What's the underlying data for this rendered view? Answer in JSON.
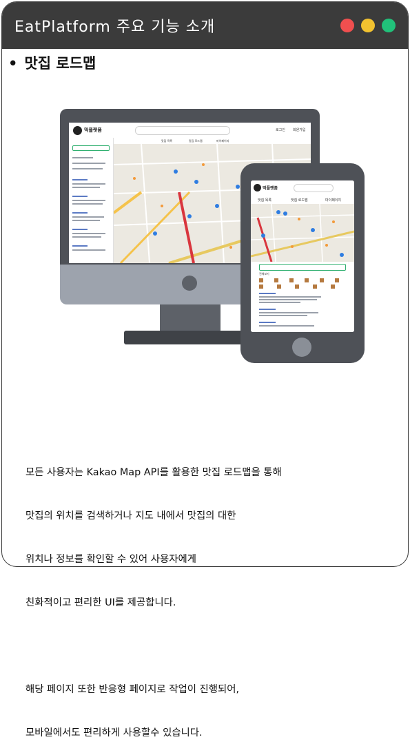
{
  "header": {
    "title": "EatPlatform 주요 기능 소개",
    "window_controls": {
      "close_color": "#f04f4f",
      "minimize_color": "#f2c230",
      "maximize_color": "#21c17a"
    }
  },
  "section": {
    "bullet": "•",
    "title": "맛집 로드맵"
  },
  "illustration": {
    "desktop": {
      "logo_text": "먹플랫폼",
      "nav": [
        "로그인",
        "회원가입"
      ],
      "tabs": [
        "맛집 목록",
        "맛집 로드맵",
        "마이페이지"
      ]
    },
    "mobile": {
      "logo_text": "먹플랫폼",
      "tabs": [
        "맛집 목록",
        "맛집 로드맵",
        "마이페이지"
      ],
      "list_heading": "전체보기"
    }
  },
  "description": {
    "paragraph1": [
      "모든 사용자는 Kakao Map API를 활용한 맛집 로드맵을 통해",
      "맛집의 위치를 검색하거나 지도 내에서 맛집의 대한",
      "위치나 정보를 확인할 수 있어 사용자에게",
      "친화적이고 편리한 UI를 제공합니다."
    ],
    "paragraph2": [
      "해당 페이지 또한 반응형 페이지로 작업이 진행되어,",
      "모바일에서도 편리하게 사용할수 있습니다."
    ]
  }
}
